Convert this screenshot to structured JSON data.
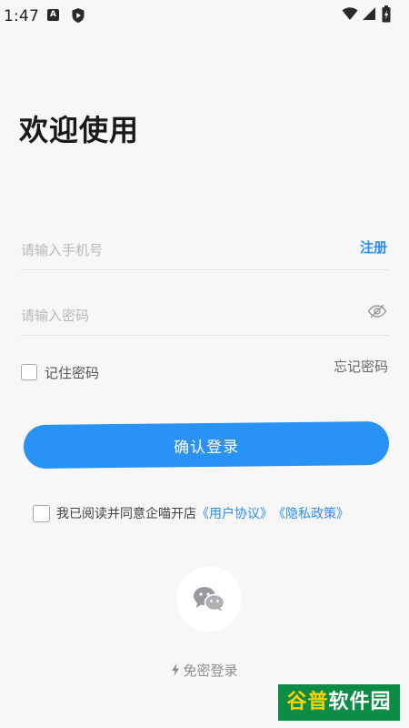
{
  "status_bar": {
    "time": "1:47",
    "icons": [
      "a-notification-icon",
      "shield-icon",
      "wifi-icon",
      "signal-icon",
      "battery-icon"
    ]
  },
  "title": "欢迎使用",
  "phone_field": {
    "placeholder": "请输入手机号",
    "value": ""
  },
  "register_label": "注册",
  "password_field": {
    "placeholder": "请输入密码",
    "value": "",
    "toggle_icon": "eye-off-icon"
  },
  "remember": {
    "label": "记住密码",
    "checked": false
  },
  "forgot_label": "忘记密码",
  "login_button_label": "确认登录",
  "agreement": {
    "prefix": "我已阅读并同意企喵开店",
    "user_agreement": "《用户协议》",
    "privacy_policy": "《隐私政策》",
    "checked": false
  },
  "wechat_icon": "wechat-icon",
  "quick_login": {
    "icon": "bolt-icon",
    "label": "免密登录"
  },
  "watermark": {
    "text_part1": "谷普",
    "text_part2": "软件园"
  },
  "colors": {
    "accent": "#2893f5",
    "link": "#2b8ef2",
    "background": "#f7f7f8",
    "watermark_bg": "#0c8c44",
    "watermark_accent": "#ffd200"
  }
}
